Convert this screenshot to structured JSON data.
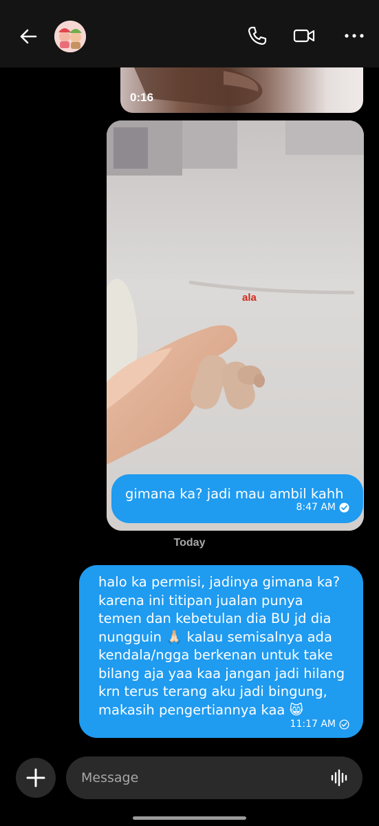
{
  "header": {
    "back_icon": "arrow-left-icon",
    "call_icon": "phone-icon",
    "video_icon": "video-camera-icon",
    "menu_icon": "more-vertical-icon"
  },
  "messages": {
    "video": {
      "duration": "0:16"
    },
    "photo": {
      "overlay_text": "ala"
    },
    "msg1": {
      "text": "gimana ka? jadi mau ambil kahh",
      "time": "8:47 AM",
      "status_icon": "read-check-icon"
    },
    "day_separator": "Today",
    "msg2": {
      "lines": [
        "halo ka permisi, jadinya gimana ka?",
        "karena ini titipan jualan punya",
        "temen dan kebetulan dia BU jd dia",
        "nungguin 🙏🏻 kalau semisalnya ada",
        "kendala/ngga berkenan untuk take",
        "bilang aja yaa kaa jangan jadi hilang",
        "krn terus terang aku jadi bingung,",
        "makasih pengertiannya kaa 😸"
      ],
      "time": "11:17 AM",
      "status_icon": "sent-check-icon"
    }
  },
  "composer": {
    "placeholder": "Message",
    "add_icon": "plus-icon",
    "voice_icon": "voice-wave-icon"
  },
  "colors": {
    "outgoing_bubble": "#1f9bf0",
    "background": "#000000",
    "header": "#141414",
    "input": "#2a2a2a"
  }
}
